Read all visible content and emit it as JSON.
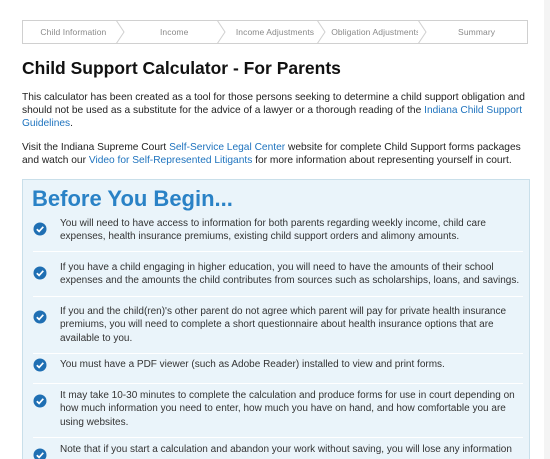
{
  "steps": [
    "Child Information",
    "Income",
    "Income Adjustments",
    "Obligation Adjustments",
    "Summary"
  ],
  "title": "Child Support Calculator - For Parents",
  "intro1": {
    "before": "This calculator has been created as a tool for those persons seeking to determine a child support obligation and should not be used as a substitute for the advice of a lawyer or a thorough reading of the ",
    "link": "Indiana Child Support Guidelines",
    "after": "."
  },
  "intro2": {
    "before": "Visit the Indiana Supreme Court ",
    "link1": "Self-Service Legal Center",
    "middle": " website for complete Child Support forms packages and watch our ",
    "link2": "Video for Self-Represented Litigants",
    "after": " for more information about representing yourself in court."
  },
  "before_you_begin": {
    "heading": "Before You Begin...",
    "items": [
      "You will need to have access to information for both parents regarding weekly income, child care expenses, health insurance premiums, existing child support orders and alimony amounts.",
      "If you have a child engaging in higher education, you will need to have the amounts of their school expenses and the amounts the child contributes from sources such as scholarships, loans, and savings.",
      "If you and the child(ren)'s other parent do not agree which parent will pay for private health insurance premiums, you will need to complete a short questionnaire about health insurance options that are available to you.",
      "You must have a PDF viewer (such as Adobe Reader) installed to view and print forms.",
      "It may take 10-30 minutes to complete the calculation and produce forms for use in court depending on how much information you need to enter, how much you have on hand, and how comfortable you are using websites.",
      "Note that if you start a calculation and abandon your work without saving, you will lose any information"
    ]
  },
  "colors": {
    "accent": "#2a82c6",
    "link": "#1e73be",
    "panel": "#eaf4fa",
    "check": "#1f6fb3"
  }
}
